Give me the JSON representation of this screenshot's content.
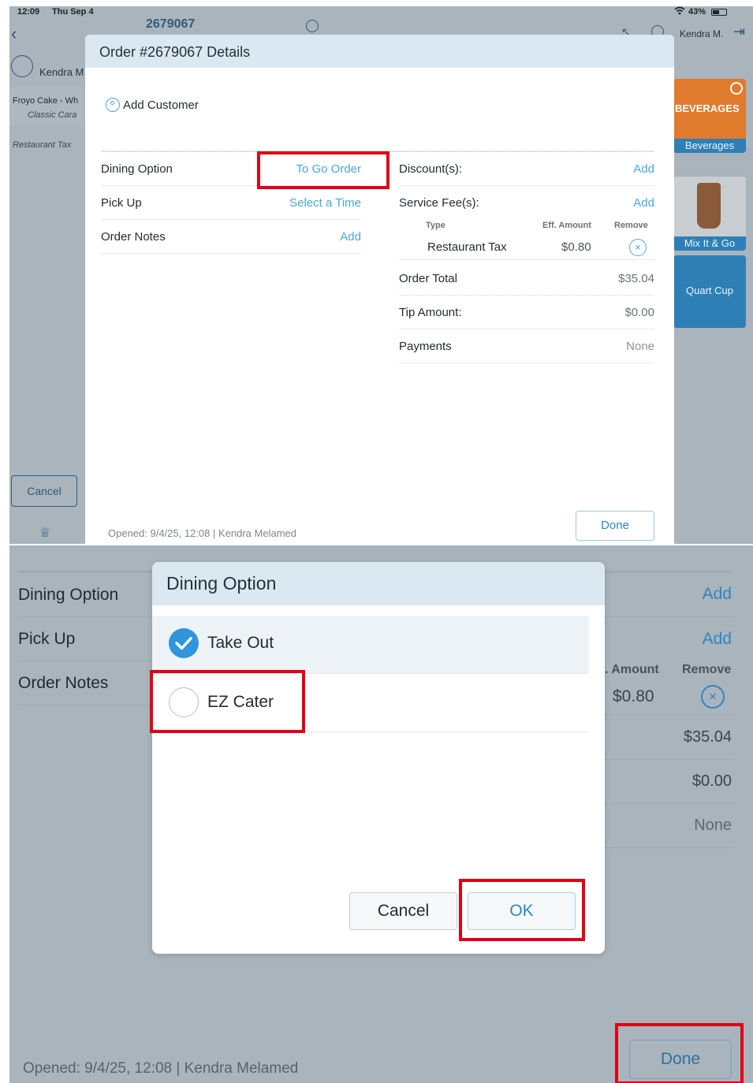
{
  "status_bar": {
    "time": "12:09",
    "date": "Thu Sep 4",
    "battery": "43%"
  },
  "background_app": {
    "order_number": "2679067",
    "user_short": "Kendra M",
    "user_top": "Kendra M.",
    "item_name": "Froyo Cake - Wh",
    "item_sub": "Classic Cara",
    "tax_line": "Restaurant Tax",
    "cancel_label": "Cancel",
    "tiles": [
      {
        "label": "Beverages",
        "banner": "BEVERAGES",
        "color": "#e07b2e"
      },
      {
        "label": "Mix It & Go",
        "color": "#2e7fb6"
      },
      {
        "label": "Quart Cup",
        "color": "#2e7fb6"
      }
    ]
  },
  "order_modal": {
    "title": "Order #2679067 Details",
    "add_customer": "Add Customer",
    "left_rows": [
      {
        "label": "Dining Option",
        "value": "To Go Order"
      },
      {
        "label": "Pick Up",
        "value": "Select a Time"
      },
      {
        "label": "Order Notes",
        "value": "Add"
      }
    ],
    "discounts": {
      "label": "Discount(s):",
      "value": "Add"
    },
    "service_fees": {
      "label": "Service Fee(s):",
      "value": "Add"
    },
    "fee_table": {
      "headers": [
        "Type",
        "Eff. Amount",
        "Remove"
      ],
      "row": {
        "type": "Restaurant Tax",
        "amount": "$0.80"
      }
    },
    "order_total": {
      "label": "Order Total",
      "value": "$35.04"
    },
    "tip": {
      "label": "Tip Amount:",
      "value": "$0.00"
    },
    "payments": {
      "label": "Payments",
      "value": "None"
    },
    "opened": "Opened:  9/4/25, 12:08 | Kendra Melamed",
    "done_label": "Done"
  },
  "bottom": {
    "left_rows": [
      "Dining Option",
      "Pick Up",
      "Order Notes"
    ],
    "right": {
      "add1": "Add",
      "add2": "Add",
      "amount_header": ". Amount",
      "remove_header": "Remove",
      "amount": "$0.80",
      "total": "$35.04",
      "tip": "$0.00",
      "payments": "None"
    },
    "opened": "Opened:  9/4/25, 12:08 | Kendra Melamed",
    "done_label": "Done"
  },
  "dining_dialog": {
    "title": "Dining Option",
    "options": [
      {
        "label": "Take Out",
        "selected": true
      },
      {
        "label": "EZ Cater",
        "selected": false
      }
    ],
    "cancel_label": "Cancel",
    "ok_label": "OK"
  },
  "colors": {
    "accent": "#4aa7dc",
    "highlight": "#e00016",
    "header_bg": "#dbe8f1",
    "dim_bg": "#a9b4bc"
  }
}
